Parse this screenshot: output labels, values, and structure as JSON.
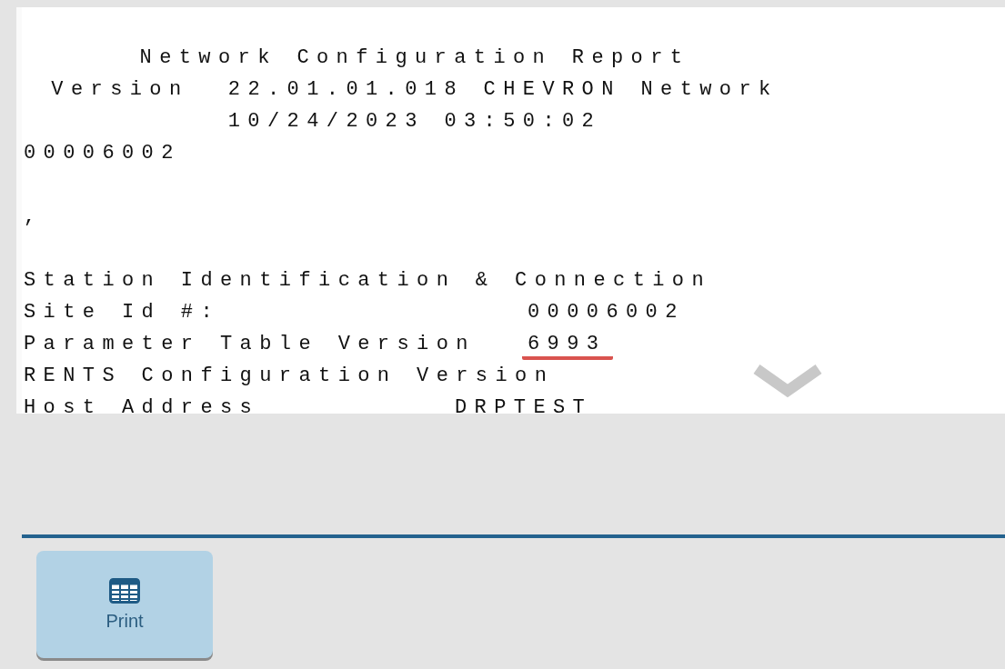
{
  "report": {
    "header": [
      "Network Configuration Report",
      "Version  22.01.01.018 CHEVRON Network",
      "10/24/2023 03:50:02"
    ],
    "lines_before": [
      "00006002",
      ","
    ],
    "section_title": "Station Identification & Connection",
    "rows": [
      {
        "kind": "aligned",
        "label": "Site Id #:",
        "value": "00006002",
        "highlighted": false
      },
      {
        "kind": "aligned",
        "label": "Parameter Table Version",
        "value": "6993",
        "highlighted": true
      },
      {
        "kind": "label_only",
        "label": "RENTS Configuration Version"
      },
      {
        "kind": "near",
        "label": "Host Address",
        "value": "DRPTEST",
        "highlighted": false
      }
    ]
  },
  "toolbar": {
    "buttons": [
      {
        "label": "Print"
      }
    ]
  }
}
